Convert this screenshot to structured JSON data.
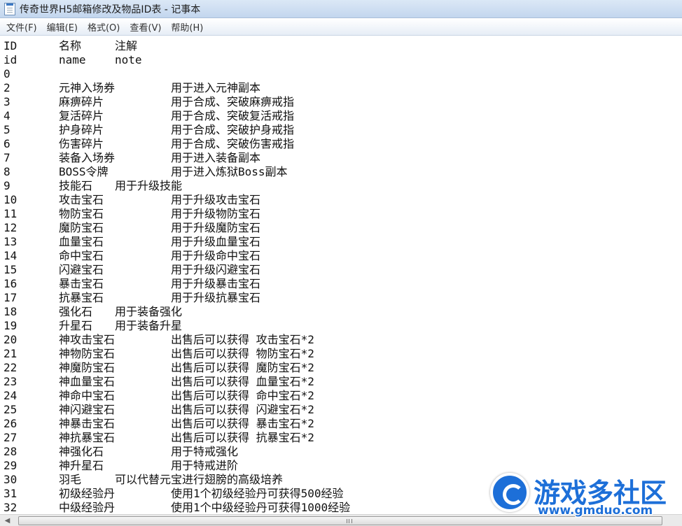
{
  "window": {
    "title": "传奇世界H5邮箱修改及物品ID表 - 记事本"
  },
  "menu": [
    "文件(F)",
    "编辑(E)",
    "格式(O)",
    "查看(V)",
    "帮助(H)"
  ],
  "rows": [
    {
      "id": "ID",
      "name": "名称",
      "note": "注解"
    },
    {
      "id": "id",
      "name": "name",
      "note": "note"
    },
    {
      "id": "0",
      "name": "",
      "note": ""
    },
    {
      "id": "2",
      "name": "元神入场券",
      "note": "用于进入元神副本"
    },
    {
      "id": "3",
      "name": "麻痹碎片",
      "note": "用于合成、突破麻痹戒指"
    },
    {
      "id": "4",
      "name": "复活碎片",
      "note": "用于合成、突破复活戒指"
    },
    {
      "id": "5",
      "name": "护身碎片",
      "note": "用于合成、突破护身戒指"
    },
    {
      "id": "6",
      "name": "伤害碎片",
      "note": "用于合成、突破伤害戒指"
    },
    {
      "id": "7",
      "name": "装备入场券",
      "note": "用于进入装备副本"
    },
    {
      "id": "8",
      "name": "BOSS令牌",
      "note": "用于进入炼狱Boss副本"
    },
    {
      "id": "9",
      "name": "技能石",
      "note": "用于升级技能"
    },
    {
      "id": "10",
      "name": "攻击宝石",
      "note": "用于升级攻击宝石"
    },
    {
      "id": "11",
      "name": "物防宝石",
      "note": "用于升级物防宝石"
    },
    {
      "id": "12",
      "name": "魔防宝石",
      "note": "用于升级魔防宝石"
    },
    {
      "id": "13",
      "name": "血量宝石",
      "note": "用于升级血量宝石"
    },
    {
      "id": "14",
      "name": "命中宝石",
      "note": "用于升级命中宝石"
    },
    {
      "id": "15",
      "name": "闪避宝石",
      "note": "用于升级闪避宝石"
    },
    {
      "id": "16",
      "name": "暴击宝石",
      "note": "用于升级暴击宝石"
    },
    {
      "id": "17",
      "name": "抗暴宝石",
      "note": "用于升级抗暴宝石"
    },
    {
      "id": "18",
      "name": "强化石",
      "note": "用于装备强化"
    },
    {
      "id": "19",
      "name": "升星石",
      "note": "用于装备升星"
    },
    {
      "id": "20",
      "name": "神攻击宝石",
      "note": "出售后可以获得 攻击宝石*2"
    },
    {
      "id": "21",
      "name": "神物防宝石",
      "note": "出售后可以获得 物防宝石*2"
    },
    {
      "id": "22",
      "name": "神魔防宝石",
      "note": "出售后可以获得 魔防宝石*2"
    },
    {
      "id": "23",
      "name": "神血量宝石",
      "note": "出售后可以获得 血量宝石*2"
    },
    {
      "id": "24",
      "name": "神命中宝石",
      "note": "出售后可以获得 命中宝石*2"
    },
    {
      "id": "25",
      "name": "神闪避宝石",
      "note": "出售后可以获得 闪避宝石*2"
    },
    {
      "id": "26",
      "name": "神暴击宝石",
      "note": "出售后可以获得 暴击宝石*2"
    },
    {
      "id": "27",
      "name": "神抗暴宝石",
      "note": "出售后可以获得 抗暴宝石*2"
    },
    {
      "id": "28",
      "name": "神强化石",
      "note": "用于特戒强化"
    },
    {
      "id": "29",
      "name": "神升星石",
      "note": "用于特戒进阶"
    },
    {
      "id": "30",
      "name": "羽毛",
      "note": "可以代替元宝进行翅膀的高级培养"
    },
    {
      "id": "31",
      "name": "初级经验丹",
      "note": "使用1个初级经验丹可获得500经验"
    },
    {
      "id": "32",
      "name": "中级经验丹",
      "note": "使用1个中级经验丹可获得1000经验"
    }
  ],
  "watermark": {
    "title": "游戏多社区",
    "url": "www.gmduo.com",
    "icon": "g-logo-icon",
    "color": "#1d6fd8"
  }
}
